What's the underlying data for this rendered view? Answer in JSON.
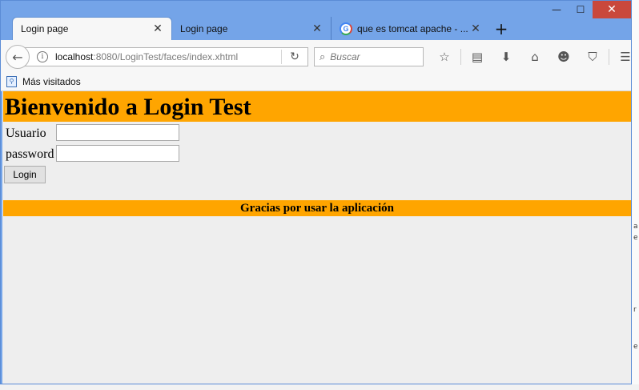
{
  "window": {
    "minimize_glyph": "—",
    "maximize_glyph": "☐",
    "close_glyph": "✕"
  },
  "tabs": [
    {
      "label": "Login page",
      "active": true
    },
    {
      "label": "Login page",
      "active": false
    },
    {
      "label": "que es tomcat apache - ...",
      "active": false,
      "favicon": "google-g-icon"
    }
  ],
  "tab_close_glyph": "✕",
  "new_tab_glyph": "+",
  "favicon_letter": "G",
  "navbar": {
    "back_glyph": "←",
    "info_glyph": "i",
    "url_host": "localhost",
    "url_rest": ":8080/LoginTest/faces/index.xhtml",
    "reload_glyph": "↻",
    "search_glyph": "⌕",
    "search_placeholder": "Buscar",
    "icons": [
      {
        "name": "bookmark-star-icon",
        "glyph": "☆"
      },
      {
        "name": "reading-list-icon",
        "glyph": "▤"
      },
      {
        "name": "download-icon",
        "glyph": "⬇"
      },
      {
        "name": "home-icon",
        "glyph": "⌂"
      },
      {
        "name": "hello-icon",
        "glyph": "☻"
      },
      {
        "name": "pocket-icon",
        "glyph": "⛉"
      },
      {
        "name": "menu-icon",
        "glyph": "☰"
      }
    ]
  },
  "bookmarks": {
    "icon_glyph": "⚲",
    "label": "Más visitados"
  },
  "page": {
    "title": "Bienvenido a Login Test",
    "username_label": "Usuario",
    "username_value": "",
    "password_label": "password",
    "password_value": "",
    "login_button": "Login",
    "footer": "Gracias por usar la aplicación",
    "banner_color": "#ffa500",
    "background_color": "#eeeeee"
  },
  "desktop_edge": [
    "a",
    "e",
    "r",
    "e"
  ]
}
